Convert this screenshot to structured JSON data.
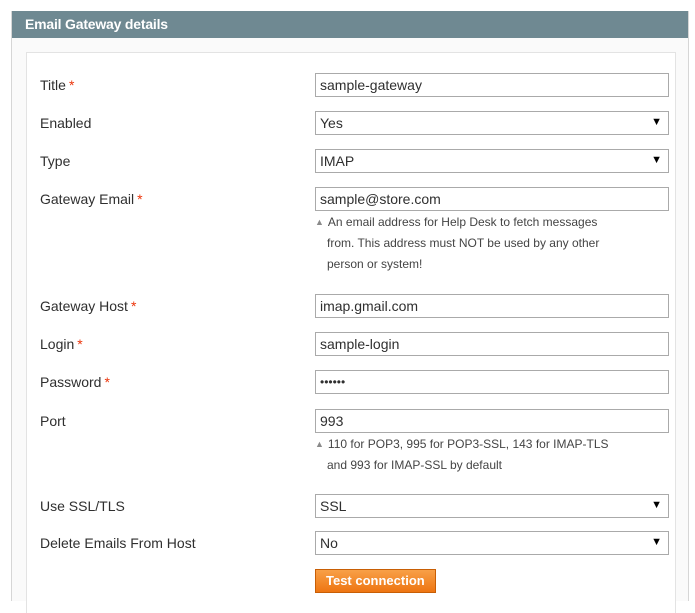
{
  "header": {
    "title": "Email Gateway details"
  },
  "required_mark": "*",
  "fields": {
    "title": {
      "label": "Title",
      "value": "sample-gateway"
    },
    "enabled": {
      "label": "Enabled",
      "value": "Yes"
    },
    "type": {
      "label": "Type",
      "value": "IMAP"
    },
    "gateway_email": {
      "label": "Gateway Email",
      "value": "sample@store.com",
      "note_line1": "An email address for Help Desk to fetch messages",
      "note_line2": "from. This address must NOT be used by any other",
      "note_line3": "person or system!"
    },
    "gateway_host": {
      "label": "Gateway Host",
      "value": "imap.gmail.com"
    },
    "login": {
      "label": "Login",
      "value": "sample-login"
    },
    "password": {
      "label": "Password",
      "value": "••••••"
    },
    "port": {
      "label": "Port",
      "value": "993",
      "note_line1": "110 for POP3, 995 for POP3-SSL, 143 for IMAP-TLS",
      "note_line2": "and 993 for IMAP-SSL by default"
    },
    "use_ssl": {
      "label": "Use SSL/TLS",
      "value": "SSL"
    },
    "delete_emails": {
      "label": "Delete Emails From Host",
      "value": "No"
    }
  },
  "buttons": {
    "test_connection": "Test connection"
  },
  "icons": {
    "select_arrow": "▼",
    "note_triangle": "▲"
  },
  "colors": {
    "header_bg": "#6f8992",
    "required": "#eb340a",
    "button": "#ee7512"
  }
}
